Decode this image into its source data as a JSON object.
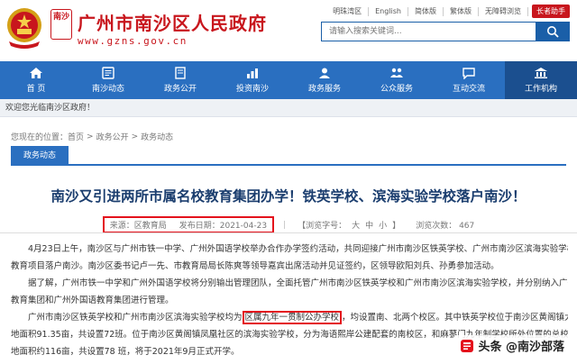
{
  "header": {
    "title": "广州市南沙区人民政府",
    "url": "www.gzns.gov.cn",
    "seal_text": "南沙",
    "toplinks": [
      "明珠湾区",
      "English",
      "简体版",
      "繁体版",
      "无障碍浏览"
    ],
    "elder_label": "长者助手",
    "search_placeholder": "请输入搜索关键词..."
  },
  "nav": {
    "items": [
      {
        "label": "首 页",
        "icon": "home-icon"
      },
      {
        "label": "南沙动态",
        "icon": "news-icon"
      },
      {
        "label": "政务公开",
        "icon": "open-gov-icon"
      },
      {
        "label": "投资南沙",
        "icon": "invest-icon"
      },
      {
        "label": "政务服务",
        "icon": "service-icon"
      },
      {
        "label": "公众服务",
        "icon": "public-service-icon"
      },
      {
        "label": "互动交流",
        "icon": "chat-icon"
      },
      {
        "label": "工作机构",
        "icon": "building-icon"
      }
    ],
    "active_index": 7
  },
  "welcome": "欢迎您光临南沙区政府！",
  "breadcrumb": {
    "prefix": "您现在的位置：",
    "items": [
      "首页",
      "政务公开",
      "政务动态"
    ]
  },
  "section": {
    "tab_label": "政务动态"
  },
  "article": {
    "title": "南沙又引进两所市属名校教育集团办学！铁英学校、滨海实验学校落户南沙！",
    "source": "来源：区教育局",
    "date": "发布日期：2021-04-23",
    "font_label": "【浏览字号：",
    "font_sizes": [
      "大",
      "中",
      "小"
    ],
    "font_close": "】",
    "views_label": "浏览次数：",
    "views": "467",
    "paragraphs": [
      "4月23日上午，南沙区与广州市铁一中学、广州外国语学校举办合作办学签约活动，共同迎接广州市南沙区铁英学校、广州市南沙区滨海实验学校两大优质",
      "教育项目落户南沙。南沙区委书记卢一先、市教育局局长陈爽等领导嘉宾出席活动并见证签约，区领导欧阳刘兵、孙勇参加活动。",
      "据了解，广州市铁一中学和广州外国语学校将分别输出管理团队，全面托管广州市南沙区铁英学校和广州市南沙区滨海实验学校，并分别纳入广州市铁一中学",
      "教育集团和广州外国语教育集团进行管理。"
    ],
    "p5_before": "广州市南沙区铁英学校和广州市南沙区滨海实验学校均为",
    "p5_highlight": "区属九年一贯制公办学校",
    "p5_after": "，均设置南、北两个校区。其中铁英学校位于南沙区黄阁镇大井村，总用",
    "p6": "地面积91.35亩，共设置72班。位于南沙区黄阁镇凤凰社区的滨海实验学校，分为海语熙岸公建配套的南校区，和麻蓼门九年制学校所处位置的总校区，总用",
    "p7": "地面积约116亩，共设置78 班，将于2021年9月正式开学。"
  },
  "watermark": "头条 @南沙部落"
}
